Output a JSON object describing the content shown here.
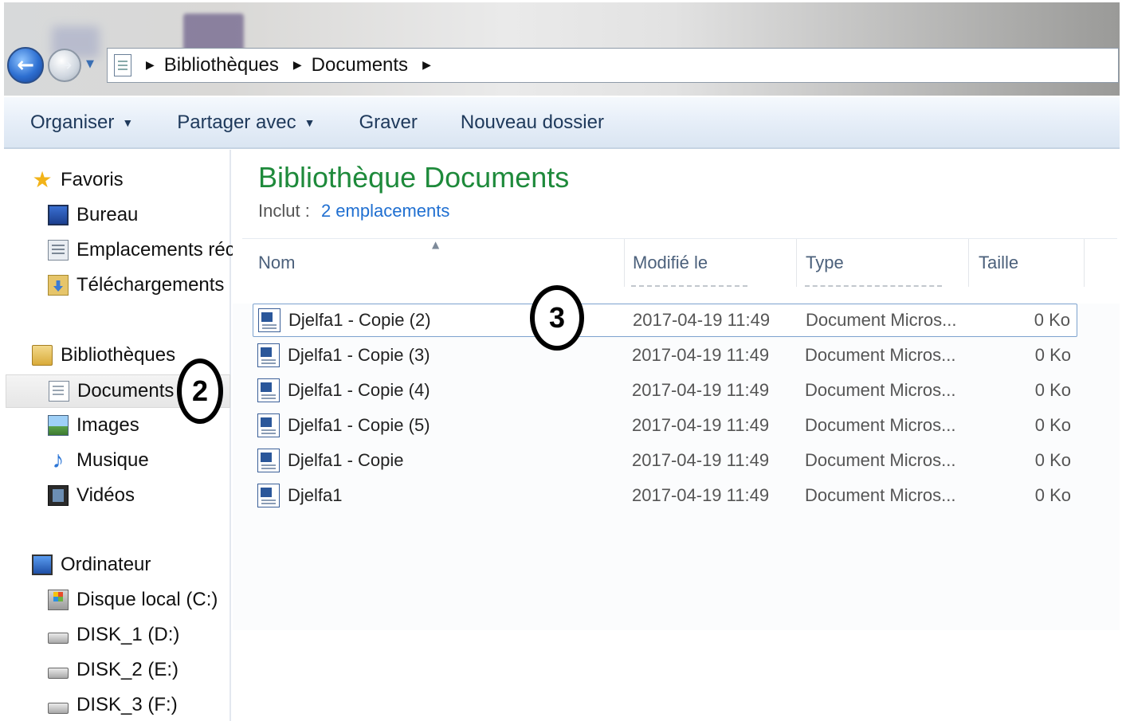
{
  "breadcrumb": [
    "Bibliothèques",
    "Documents"
  ],
  "toolbar": {
    "organise": "Organiser",
    "share": "Partager avec",
    "burn": "Graver",
    "new_folder": "Nouveau dossier"
  },
  "nav": {
    "favorites_header": "Favoris",
    "favorites": [
      "Bureau",
      "Emplacements récer",
      "Téléchargements"
    ],
    "libraries_header": "Bibliothèques",
    "libraries": [
      "Documents",
      "Images",
      "Musique",
      "Vidéos"
    ],
    "computer_header": "Ordinateur",
    "drives": [
      "Disque local (C:)",
      "DISK_1 (D:)",
      "DISK_2 (E:)",
      "DISK_3 (F:)"
    ]
  },
  "library": {
    "title": "Bibliothèque Documents",
    "includes_label": "Inclut :",
    "includes_link": "2 emplacements"
  },
  "columns": {
    "name": "Nom",
    "modified": "Modifié le",
    "type": "Type",
    "size": "Taille"
  },
  "files": [
    {
      "name": "Djelfa1 - Copie (2)",
      "date": "2017-04-19 11:49",
      "type": "Document Micros...",
      "size": "0 Ko"
    },
    {
      "name": "Djelfa1 - Copie (3)",
      "date": "2017-04-19 11:49",
      "type": "Document Micros...",
      "size": "0 Ko"
    },
    {
      "name": "Djelfa1 - Copie (4)",
      "date": "2017-04-19 11:49",
      "type": "Document Micros...",
      "size": "0 Ko"
    },
    {
      "name": "Djelfa1 - Copie (5)",
      "date": "2017-04-19 11:49",
      "type": "Document Micros...",
      "size": "0 Ko"
    },
    {
      "name": "Djelfa1 - Copie",
      "date": "2017-04-19 11:49",
      "type": "Document Micros...",
      "size": "0 Ko"
    },
    {
      "name": "Djelfa1",
      "date": "2017-04-19 11:49",
      "type": "Document Micros...",
      "size": "0 Ko"
    }
  ],
  "selected_file_index": 0,
  "callouts": [
    "2",
    "3"
  ],
  "colors": {
    "title_green": "#1e8a3b",
    "link_blue": "#1f6fd1",
    "toolbar_text": "#1e395b"
  }
}
